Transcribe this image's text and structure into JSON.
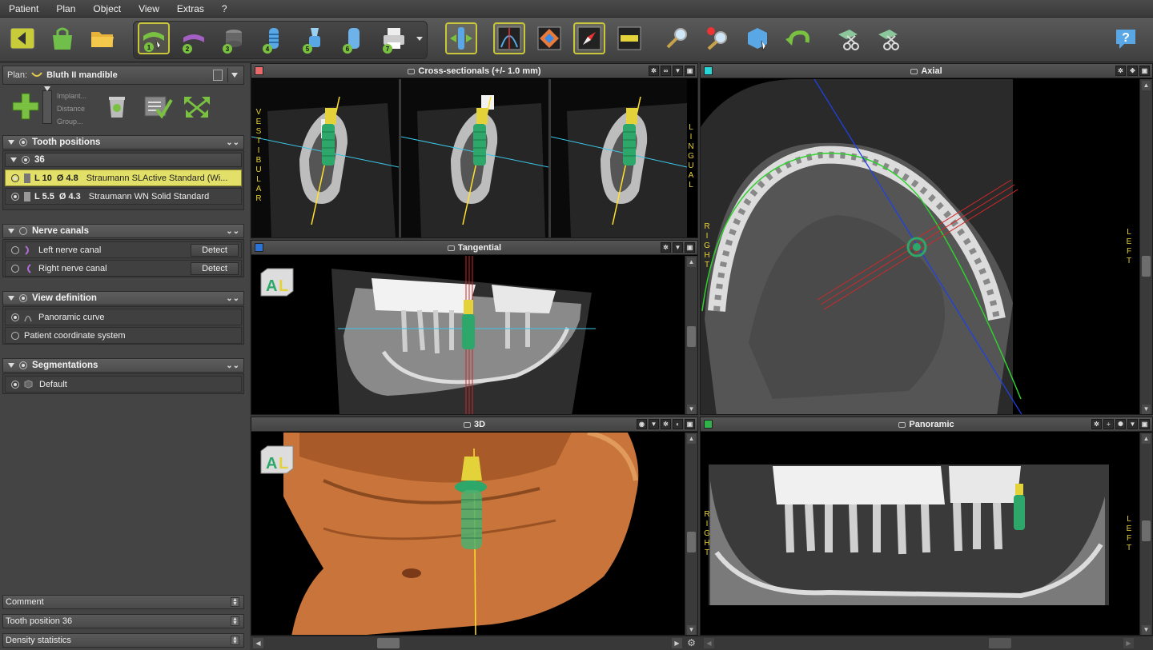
{
  "menu": [
    "Patient",
    "Plan",
    "Object",
    "View",
    "Extras",
    "?"
  ],
  "toolbar": {
    "step_numbers": [
      "1",
      "2",
      "3",
      "4",
      "5",
      "6",
      "7"
    ]
  },
  "plan": {
    "label": "Plan:",
    "name": "Bluth II  mandible"
  },
  "add_menu": {
    "items": [
      "Implant...",
      "Distance",
      "Group..."
    ]
  },
  "sections": {
    "tooth_positions": {
      "title": "Tooth positions",
      "group": "36",
      "implants": [
        {
          "length": "L 10",
          "diameter": "Ø 4.8",
          "name": "Straumann SLActive Standard (Wi..."
        },
        {
          "length": "L 5.5",
          "diameter": "Ø 4.3",
          "name": "Straumann WN Solid Standard"
        }
      ]
    },
    "nerve_canals": {
      "title": "Nerve canals",
      "items": [
        {
          "label": "Left nerve canal",
          "button": "Detect"
        },
        {
          "label": "Right nerve canal",
          "button": "Detect"
        }
      ]
    },
    "view_definition": {
      "title": "View definition",
      "items": [
        "Panoramic curve",
        "Patient coordinate system"
      ]
    },
    "segmentations": {
      "title": "Segmentations",
      "items": [
        "Default"
      ]
    }
  },
  "bottom_sections": [
    "Comment",
    "Tooth position 36",
    "Density statistics"
  ],
  "viewports": {
    "cross": {
      "title": "Cross-sectionals (+/- 1.0 mm)",
      "left_label": [
        "V",
        "E",
        "S",
        "T",
        "I",
        "B",
        "U",
        "L",
        "A",
        "R"
      ],
      "right_label": [
        "L",
        "I",
        "N",
        "G",
        "U",
        "A",
        "L"
      ]
    },
    "axial": {
      "title": "Axial",
      "left_label": [
        "R",
        "I",
        "G",
        "H",
        "T"
      ],
      "right_label": [
        "L",
        "E",
        "F",
        "T"
      ]
    },
    "tangential": {
      "title": "Tangential",
      "cube": "L"
    },
    "threed": {
      "title": "3D",
      "cube": "L"
    },
    "panoramic": {
      "title": "Panoramic",
      "left_label": [
        "R",
        "I",
        "G",
        "H",
        "T"
      ],
      "right_label": [
        "L",
        "E",
        "F",
        "T"
      ]
    }
  },
  "colors": {
    "cross": "#e86a6a",
    "axial": "#29d6d6",
    "tangential": "#2b73d6",
    "panoramic": "#2fb24a",
    "highlight": "#e3e06a"
  }
}
